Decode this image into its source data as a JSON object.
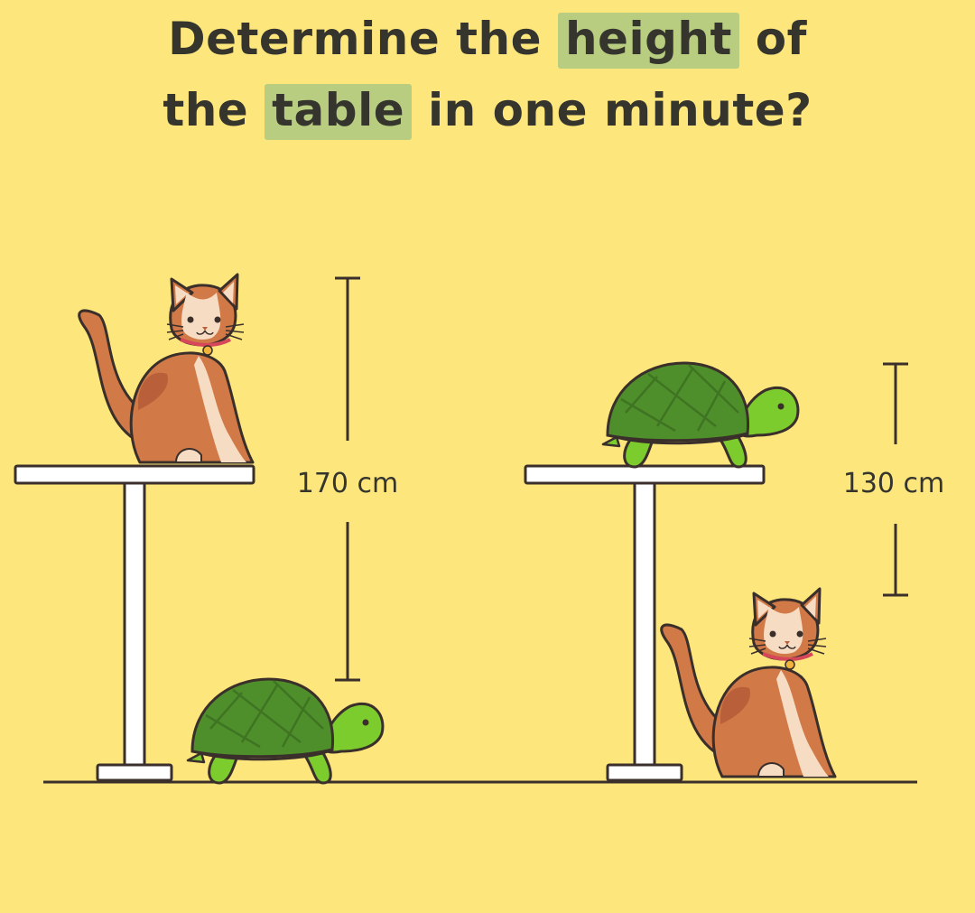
{
  "title": {
    "line1_before": "Determine the ",
    "line1_highlight": "height",
    "line1_after": " of",
    "line2_before": "the ",
    "line2_highlight": "table",
    "line2_after": " in one minute?"
  },
  "measurements": {
    "left_label": "170 cm",
    "right_label": "130 cm"
  },
  "colors": {
    "background": "#fde67c",
    "highlight": "#b9cd80",
    "text": "#35352e",
    "table": "#ffffff",
    "outline": "#3a2f2a",
    "cat_orange": "#d27a47",
    "cat_cream": "#f7dcc4",
    "turtle_shell": "#4f8f2b",
    "turtle_body": "#7ccc2e"
  }
}
